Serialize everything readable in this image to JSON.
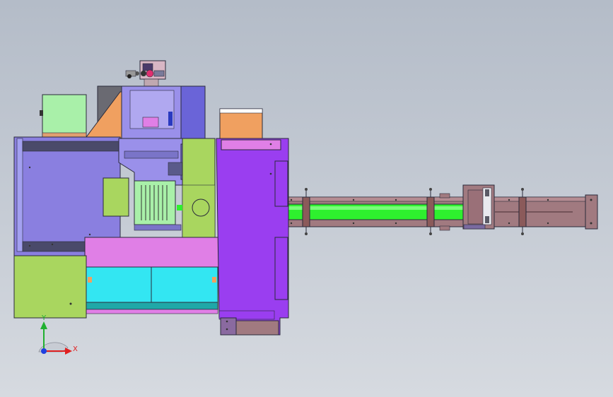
{
  "colors": {
    "background_top": "#b4bcc8",
    "background_bottom": "#d6dae0",
    "body_violet": "#8a7fe0",
    "panel_lavender": "#9a90ea",
    "frame_purple": "#9a3ef0",
    "pink_magenta": "#e07fe6",
    "lime": "#a9d65f",
    "cyan": "#33e6f2",
    "teal_dark": "#1fa8a8",
    "orange": "#f0a060",
    "mint": "#a9f0a9",
    "brown_rail": "#a17a80",
    "green_shaft": "#2ef02e",
    "slate_blue": "#6a64d8"
  },
  "axes": {
    "x_label": "X",
    "y_label": "Y",
    "x_color": "#e02020",
    "y_color": "#20b030",
    "z_color": "#2040e0"
  },
  "icons": {
    "triad": "coordinate-triad-icon"
  }
}
